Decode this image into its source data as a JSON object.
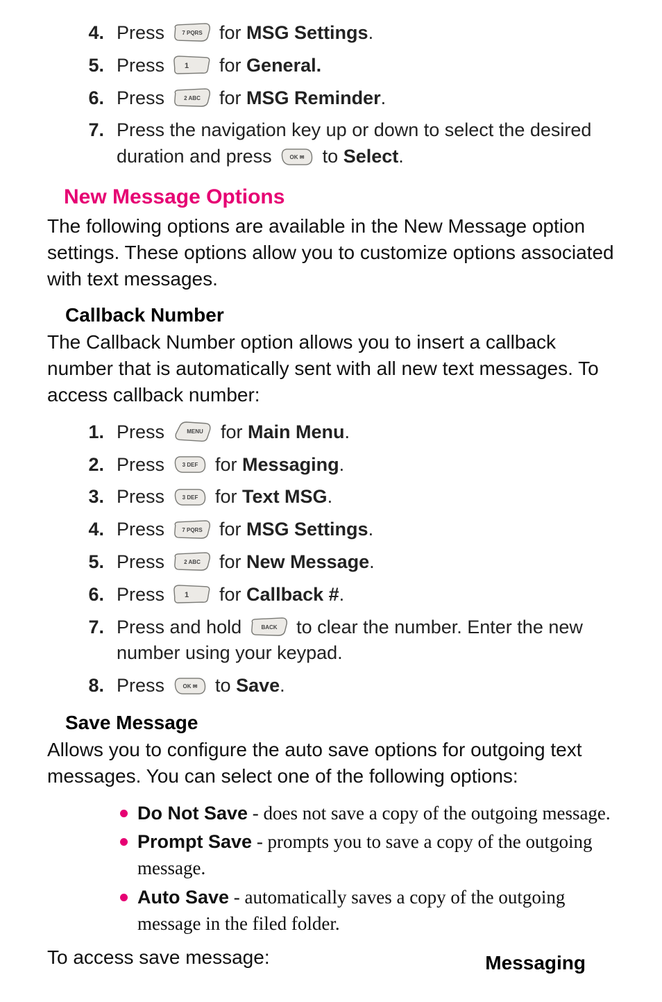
{
  "topSteps": [
    {
      "num": "4.",
      "prefix": "Press ",
      "key": "7pqrs",
      "mid": " for ",
      "bold": "MSG Settings",
      "suffix": "."
    },
    {
      "num": "5.",
      "prefix": "Press ",
      "key": "1",
      "mid": " for ",
      "bold": "General.",
      "suffix": ""
    },
    {
      "num": "6.",
      "prefix": "Press ",
      "key": "2abc",
      "mid": " for ",
      "bold": "MSG Reminder",
      "suffix": "."
    },
    {
      "num": "7.",
      "prefix": "Press the navigation key up or down to select the desired duration and press ",
      "key": "ok",
      "mid": " to ",
      "bold": "Select",
      "suffix": "."
    }
  ],
  "newMsg": {
    "title": "New Message Options",
    "intro": "The following options are available in the New Message option settings. These options allow you to customize options associated with text messages."
  },
  "callback": {
    "title": "Callback Number",
    "intro": "The Callback Number option allows you to insert a callback number that is automatically sent with all new text messages. To access callback number:",
    "steps": [
      {
        "num": "1.",
        "prefix": "Press ",
        "key": "menu",
        "mid": " for ",
        "bold": "Main Menu",
        "suffix": "."
      },
      {
        "num": "2.",
        "prefix": "Press ",
        "key": "3def",
        "mid": " for ",
        "bold": "Messaging",
        "suffix": "."
      },
      {
        "num": "3.",
        "prefix": "Press ",
        "key": "3def",
        "mid": " for ",
        "bold": "Text MSG",
        "suffix": "."
      },
      {
        "num": "4.",
        "prefix": "Press ",
        "key": "7pqrs",
        "mid": " for ",
        "bold": "MSG Settings",
        "suffix": "."
      },
      {
        "num": "5.",
        "prefix": "Press ",
        "key": "2abc",
        "mid": " for ",
        "bold": "New Message",
        "suffix": "."
      },
      {
        "num": "6.",
        "prefix": "Press ",
        "key": "1",
        "mid": " for ",
        "bold": "Callback #",
        "suffix": "."
      },
      {
        "num": "7.",
        "prefix": "Press and hold ",
        "key": "back",
        "mid": " to clear the number. Enter the new number using your keypad.",
        "bold": "",
        "suffix": ""
      },
      {
        "num": "8.",
        "prefix": "Press ",
        "key": "ok",
        "mid": " to ",
        "bold": "Save",
        "suffix": "."
      }
    ]
  },
  "saveMsg": {
    "title": "Save Message",
    "intro": "Allows you to configure the auto save options for outgoing text messages. You can select one of the following options:",
    "bullets": [
      {
        "lead": "Do Not Save",
        "rest": " - does not save a copy of the outgoing message."
      },
      {
        "lead": "Prompt Save",
        "rest": " - prompts you to save a copy of the outgoing message."
      },
      {
        "lead": "Auto Save",
        "rest": " - automatically saves a copy of the outgoing message in the filed folder."
      }
    ],
    "outro": "To access save message:"
  },
  "footer": "Messaging"
}
